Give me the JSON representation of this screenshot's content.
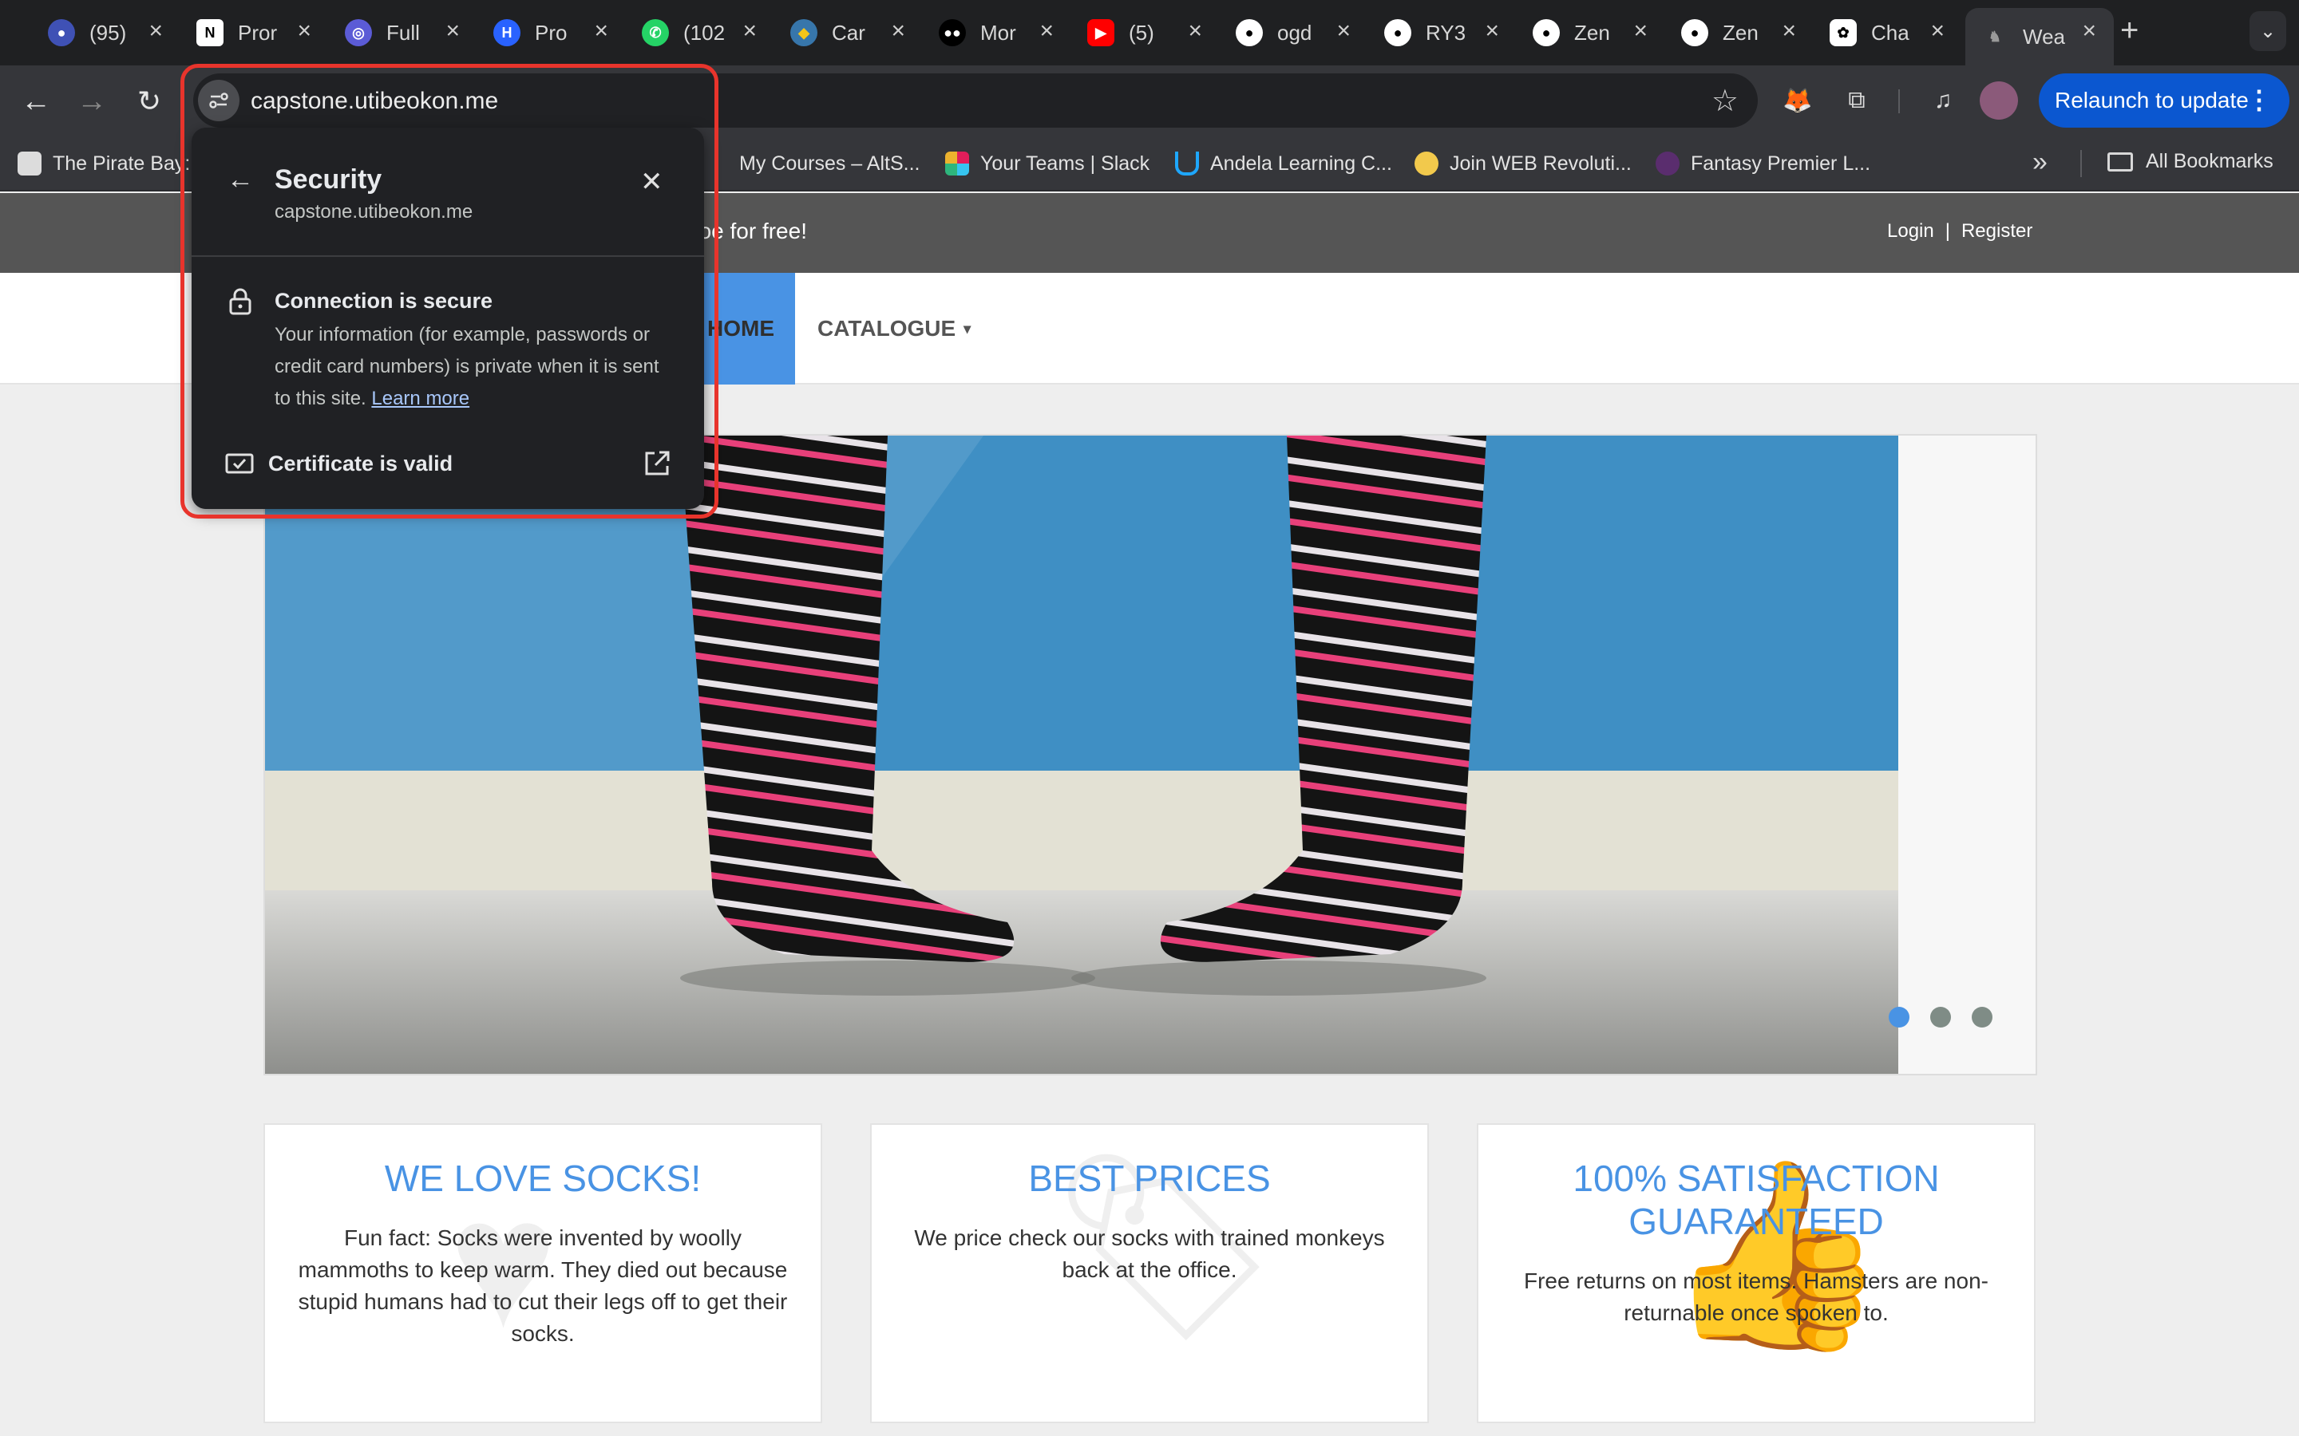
{
  "browser": {
    "tabs": [
      {
        "label": "(95)",
        "icon": "badge-icon",
        "color": "#3f51b5"
      },
      {
        "label": "Pror",
        "icon": "notion-icon",
        "color": "#ffffff"
      },
      {
        "label": "Full",
        "icon": "globe-icon",
        "color": "#5b5bd6"
      },
      {
        "label": "Pro",
        "icon": "hashnode-icon",
        "color": "#2962ff"
      },
      {
        "label": "(102",
        "icon": "whatsapp-icon",
        "color": "#25d366"
      },
      {
        "label": "Car",
        "icon": "python-icon",
        "color": "#f5c518"
      },
      {
        "label": "Mor",
        "icon": "medium-icon",
        "color": "#000000"
      },
      {
        "label": "(5)",
        "icon": "youtube-icon",
        "color": "#ff0000"
      },
      {
        "label": "ogd",
        "icon": "github-icon",
        "color": "#ffffff"
      },
      {
        "label": "RY3",
        "icon": "github-icon",
        "color": "#ffffff"
      },
      {
        "label": "Zen",
        "icon": "github-icon",
        "color": "#ffffff"
      },
      {
        "label": "Zen",
        "icon": "github-icon",
        "color": "#ffffff"
      },
      {
        "label": "Cha",
        "icon": "openai-icon",
        "color": "#ffffff"
      },
      {
        "label": "Wea",
        "icon": "sock-icon",
        "color": "#888888"
      }
    ],
    "new_tab": "+",
    "tab_search": "⌄",
    "url": "capstone.utibeokon.me",
    "relaunch_label": "Relaunch to update",
    "relaunch_menu": "⋮",
    "bookmarks": [
      {
        "label": "The Pirate Bay:"
      },
      {
        "label": "My Courses – AltS..."
      },
      {
        "label": "Your Teams | Slack"
      },
      {
        "label": "Andela Learning C..."
      },
      {
        "label": "Join WEB Revoluti..."
      },
      {
        "label": "Fantasy Premier L..."
      }
    ],
    "bookmarks_overflow": "»",
    "all_bookmarks": "All Bookmarks"
  },
  "security_popup": {
    "back": "←",
    "title": "Security",
    "domain": "capstone.utibeokon.me",
    "close": "✕",
    "connection_title": "Connection is secure",
    "connection_desc": "Your information (for example, passwords or credit card numbers) is private when it is sent to this site.",
    "learn_more": "Learn more",
    "certificate_label": "Certificate is valid"
  },
  "site": {
    "promo_text": "hoe for free!",
    "login": "Login",
    "separator": "|",
    "register": "Register",
    "nav": {
      "home": "HOME",
      "catalogue": "CATALOGUE",
      "caret": "▾"
    },
    "carousel": {
      "slide_count": 3,
      "active_slide": 1
    },
    "features": [
      {
        "title": "WE LOVE SOCKS!",
        "text": "Fun fact: Socks were invented by woolly mammoths to keep warm. They died out because stupid humans had to cut their legs off to get their socks."
      },
      {
        "title": "BEST PRICES",
        "text": "We price check our socks with trained monkeys back at the office."
      },
      {
        "title": "100% SATISFACTION GUARANTEED",
        "text": "Free returns on most items. Hamsters are non-returnable once spoken to."
      }
    ]
  },
  "colors": {
    "accent_blue": "#4993e4",
    "chrome_dark": "#35363a",
    "highlight_red": "#e8342c",
    "relaunch_blue": "#0b57d0"
  }
}
